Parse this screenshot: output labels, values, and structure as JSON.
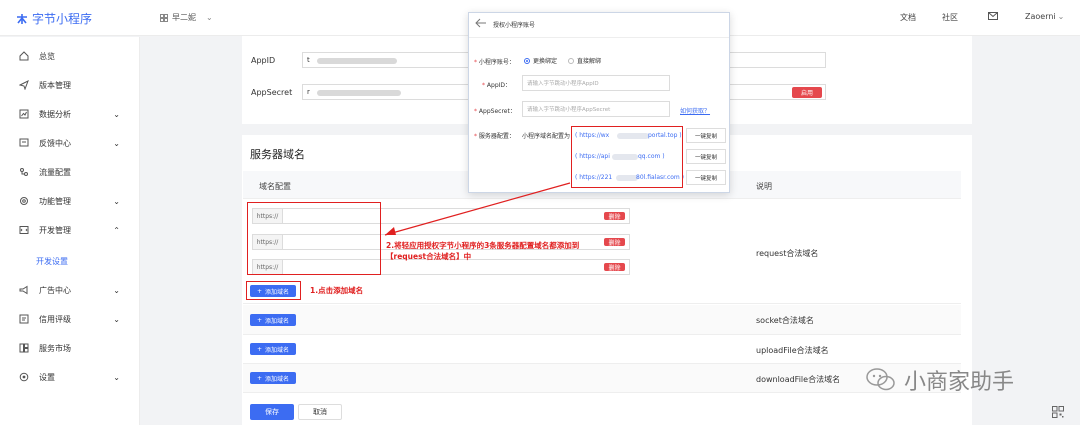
{
  "app": {
    "logo_text": "字节小程序",
    "team": "早二妮"
  },
  "topnav": {
    "doc": "文档",
    "community": "社区",
    "user": "Zaoerni"
  },
  "sidebar": {
    "items": [
      {
        "label": "总览",
        "icon": "home-icon"
      },
      {
        "label": "版本管理",
        "icon": "send-icon"
      },
      {
        "label": "数据分析",
        "icon": "chart-icon"
      },
      {
        "label": "反馈中心",
        "icon": "message-icon"
      },
      {
        "label": "流量配置",
        "icon": "flow-icon"
      },
      {
        "label": "功能管理",
        "icon": "gear-icon"
      },
      {
        "label": "开发管理",
        "icon": "code-icon"
      },
      {
        "label": "开发设置",
        "icon": ""
      },
      {
        "label": "广告中心",
        "icon": "megaphone-icon"
      },
      {
        "label": "信用评级",
        "icon": "rating-icon"
      },
      {
        "label": "服务市场",
        "icon": "market-icon"
      },
      {
        "label": "设置",
        "icon": "settings-icon"
      }
    ]
  },
  "credentials": {
    "appid_label": "AppID",
    "appid_value": "t",
    "appsecret_label": "AppSecret",
    "appsecret_value": "r",
    "enable_label": "启用"
  },
  "server": {
    "title": "服务器域名",
    "col_domain": "域名配置",
    "col_desc": "说明",
    "prefix": "https://",
    "delete_label": "删除",
    "add_label": "添加域名",
    "rows": [
      {
        "desc": "request合法域名"
      },
      {
        "desc": "socket合法域名"
      },
      {
        "desc": "uploadFile合法域名"
      },
      {
        "desc": "downloadFile合法域名"
      }
    ],
    "save_label": "保存",
    "cancel_label": "取消"
  },
  "modal": {
    "title": "授权小程序账号",
    "account_label": "小程序账号：",
    "radio_bind": "更换绑定",
    "radio_unbind": "直接解绑",
    "appid_label": "AppID：",
    "appid_placeholder": "请输入字节跳动小程序AppID",
    "appsecret_label": "AppSecret：",
    "appsecret_placeholder": "请输入字节跳动小程序AppSecret",
    "how_to_get": "如何获取？",
    "server_label": "服务器配置：",
    "server_hint": "小程序域名配置为",
    "urls": [
      "( https://wx",
      "portal.top )",
      "( https://api",
      "qq.com )",
      "( https://221",
      "80l.fialasr.com )"
    ],
    "copy_label": "一键复制"
  },
  "annotations": {
    "step1": "1.点击添加域名",
    "step2_line1": "2.将轻应用授权字节小程序的3条服务器配置域名都添加到",
    "step2_line2": "【request合法域名】中"
  },
  "watermark": "小商家助手",
  "colors": {
    "accent": "#3c6cf2",
    "danger": "#e5484d",
    "annotation": "#e02020"
  }
}
